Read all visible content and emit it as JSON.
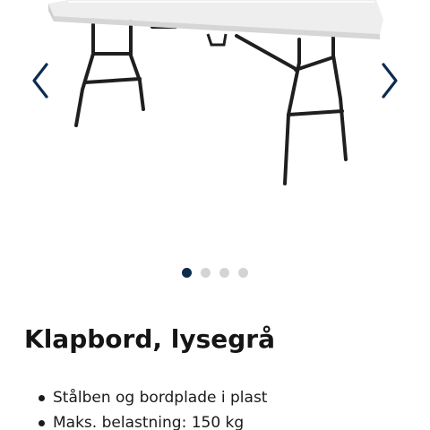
{
  "gallery": {
    "image_subject": "folding-table",
    "prev_icon": "chevron-left-icon",
    "next_icon": "chevron-right-icon",
    "arrow_color": "#0d2b4f",
    "slide_count": 4,
    "active_slide": 1
  },
  "product": {
    "title": "Klapbord, lysegrå",
    "features": [
      "Stålben og bordplade i plast",
      "Maks. belastning: 150 kg"
    ]
  },
  "colors": {
    "dot_active": "#0d2b4f",
    "dot_inactive": "#d4d4d4"
  }
}
